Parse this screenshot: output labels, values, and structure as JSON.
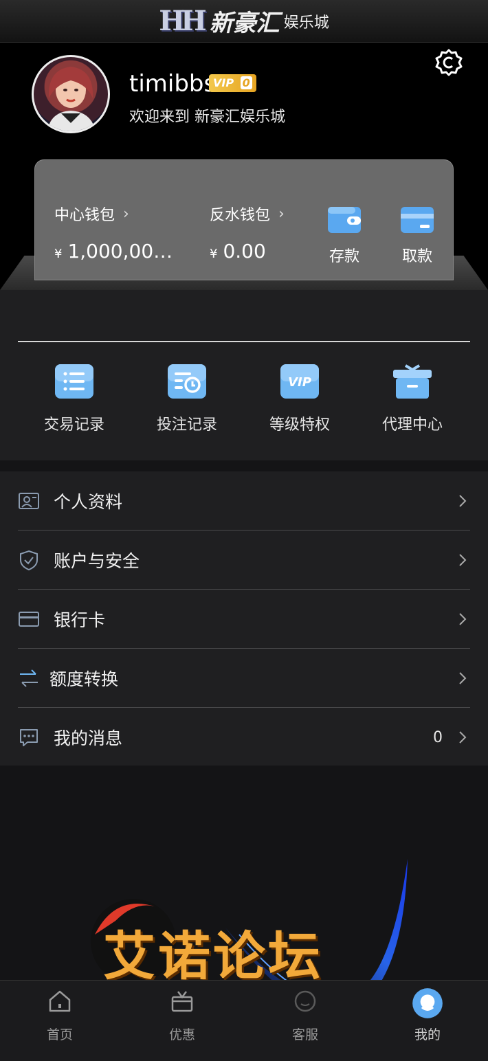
{
  "brand": {
    "logo": "HH",
    "name": "新豪汇",
    "sub": "娱乐城"
  },
  "profile": {
    "username": "timibbs",
    "vip_label": "VIP",
    "vip_level": "0",
    "welcome": "欢迎来到 新豪汇娱乐城"
  },
  "wallet": {
    "currency": "¥",
    "center_label": "中心钱包",
    "center_value": "1,000,00…",
    "rebate_label": "反水钱包",
    "rebate_value": "0.00",
    "deposit_label": "存款",
    "withdraw_label": "取款"
  },
  "quick_grid": [
    {
      "label": "交易记录",
      "icon": "list-icon"
    },
    {
      "label": "投注记录",
      "icon": "bet-record-icon"
    },
    {
      "label": "等级特权",
      "icon": "vip-icon"
    },
    {
      "label": "代理中心",
      "icon": "gift-box-icon"
    }
  ],
  "menu": [
    {
      "label": "个人资料",
      "icon": "profile-card-icon"
    },
    {
      "label": "账户与安全",
      "icon": "shield-icon"
    },
    {
      "label": "银行卡",
      "icon": "bank-card-icon"
    },
    {
      "label": "额度转换",
      "icon": "transfer-icon"
    },
    {
      "label": "我的消息",
      "icon": "message-icon",
      "count": "0"
    }
  ],
  "watermark": {
    "text": "艾诺论坛"
  },
  "tabbar": [
    {
      "label": "首页",
      "icon": "home-icon"
    },
    {
      "label": "优惠",
      "icon": "gift-icon"
    },
    {
      "label": "客服",
      "icon": "support-icon"
    },
    {
      "label": "我的",
      "icon": "my-icon",
      "active": true
    }
  ],
  "colors": {
    "accent_blue": "#5aa8f0",
    "vip_gold": "#f3c84b",
    "watermark_orange": "#f2a93a"
  }
}
